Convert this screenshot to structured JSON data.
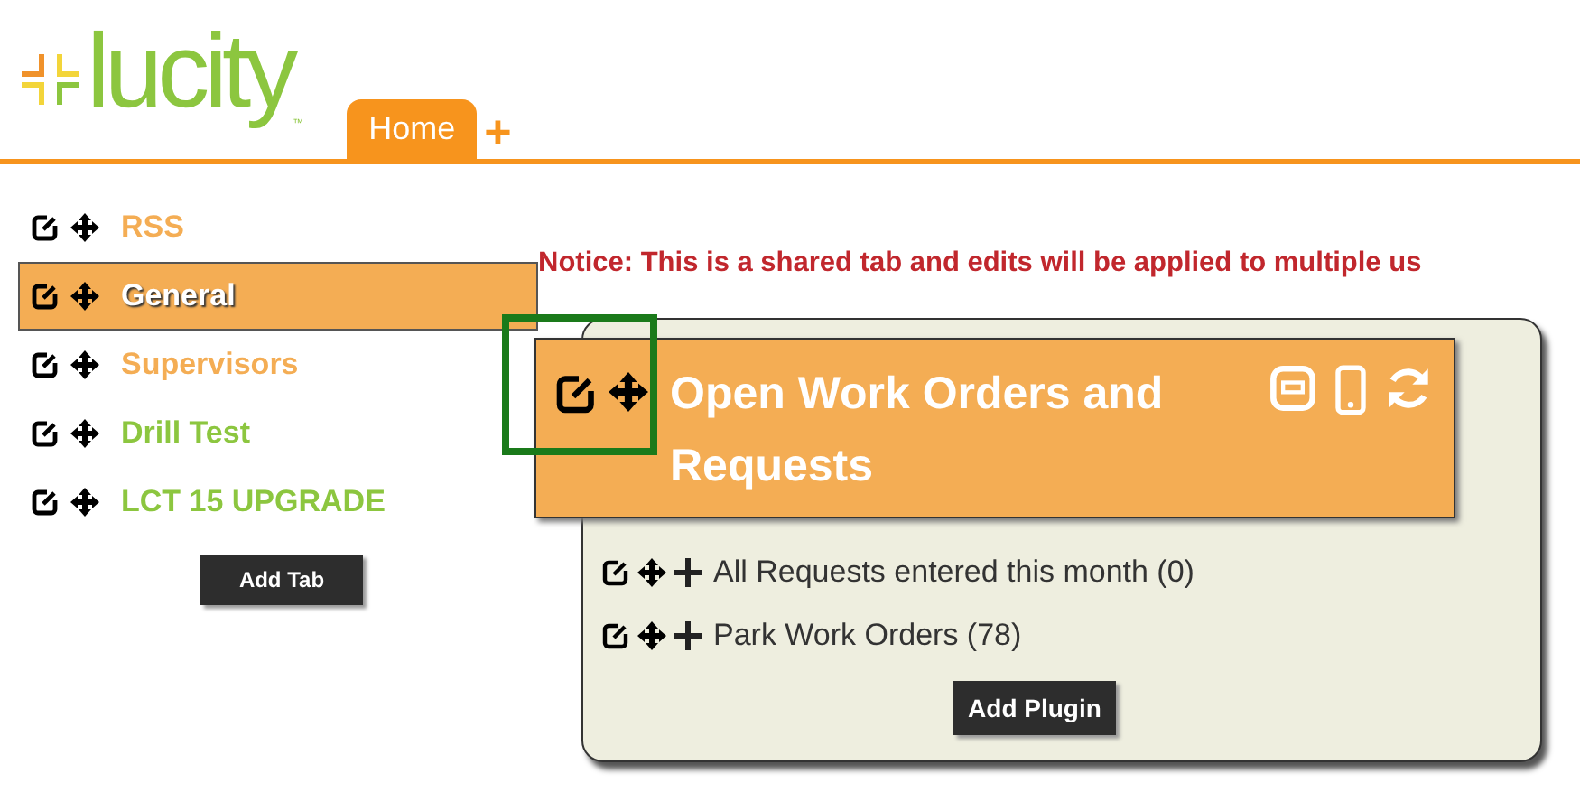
{
  "logo": {
    "text": "lucity",
    "trademark": "™"
  },
  "tabs": [
    {
      "label": "Home",
      "selected": true
    }
  ],
  "add_tab_symbol": "+",
  "sidebar": {
    "items": [
      {
        "label": "RSS",
        "selected": false,
        "color": "#f4ad54"
      },
      {
        "label": "General",
        "selected": true
      },
      {
        "label": "Supervisors",
        "selected": false,
        "color": "#f4ad54"
      },
      {
        "label": "Drill Test",
        "selected": false,
        "color": "#8cc63f"
      },
      {
        "label": "LCT 15 UPGRADE",
        "selected": false,
        "color": "#8cc63f"
      }
    ],
    "add_button": "Add Tab"
  },
  "notice": "Notice: This is a shared tab and edits will be applied to multiple us",
  "panel": {
    "title": "Open Work Orders and Requests",
    "items": [
      "All Requests entered this month (0)",
      "Park Work Orders (78)"
    ],
    "add_button": "Add Plugin"
  }
}
